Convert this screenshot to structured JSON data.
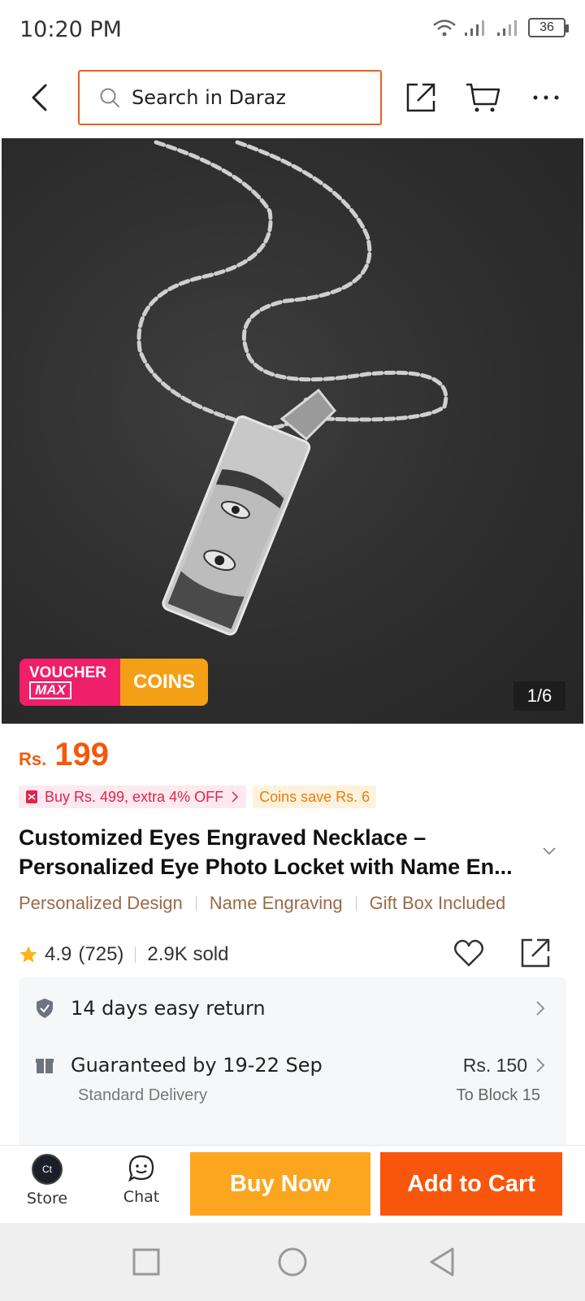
{
  "status_bar": {
    "time": "10:20 PM",
    "battery": "36"
  },
  "top_nav": {
    "search_placeholder": "Search in Daraz"
  },
  "product_image": {
    "voucher_line1": "VOUCHER",
    "voucher_line2": "MAX",
    "coins_label": "COINS",
    "image_counter": "1/6"
  },
  "price": {
    "currency": "Rs.",
    "value": "199"
  },
  "promos": {
    "voucher_text": "Buy Rs. 499, extra 4% OFF",
    "coins_text": "Coins save Rs. 6"
  },
  "product": {
    "title_line1": "Customized Eyes Engraved Necklace –",
    "title_line2": "Personalized Eye Photo Locket with Name En...",
    "features": [
      "Personalized Design",
      "Name Engraving",
      "Gift Box Included"
    ]
  },
  "rating": {
    "score": "4.9",
    "count": "(725)",
    "sold": "2.9K sold"
  },
  "services": {
    "return_text": "14 days easy return",
    "delivery_text": "Guaranteed by 19-22 Sep",
    "delivery_type": "Standard Delivery",
    "delivery_price": "Rs. 150",
    "delivery_location": "To Block 15"
  },
  "action_bar": {
    "store_label": "Store",
    "store_avatar_text": "Ct",
    "chat_label": "Chat",
    "buy_now_label": "Buy Now",
    "add_to_cart_label": "Add to Cart"
  },
  "colors": {
    "brand_orange": "#f8560c",
    "buy_now_yellow": "#fca51f",
    "search_border": "#e8601c",
    "voucher_pink": "#f01f6a"
  }
}
